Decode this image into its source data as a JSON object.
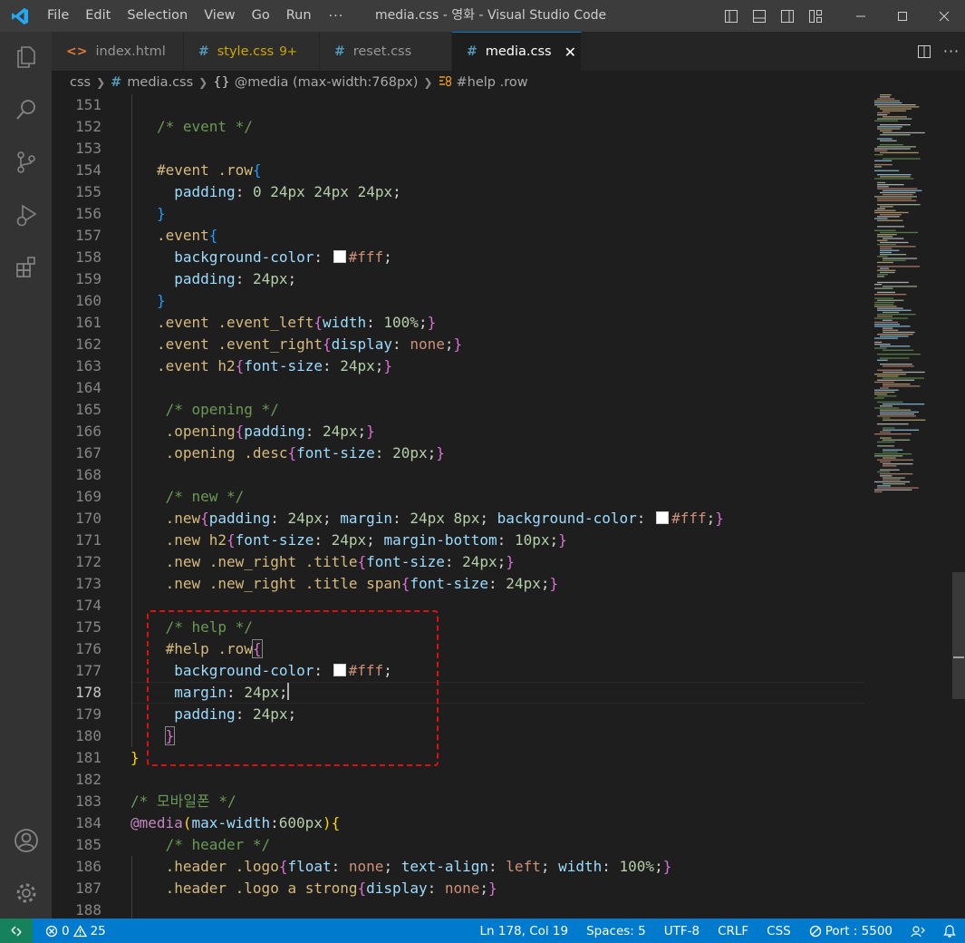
{
  "window": {
    "title": "media.css - 영화 - Visual Studio Code",
    "menu": [
      "File",
      "Edit",
      "Selection",
      "View",
      "Go",
      "Run"
    ],
    "menu_more": "···"
  },
  "tabs": [
    {
      "label": "index.html",
      "icon": "html-icon",
      "active": false
    },
    {
      "label": "style.css",
      "icon": "css-icon",
      "active": false,
      "count": "9+"
    },
    {
      "label": "reset.css",
      "icon": "css-icon",
      "active": false
    },
    {
      "label": "media.css",
      "icon": "css-icon",
      "active": true,
      "close": "✕"
    }
  ],
  "breadcrumb": {
    "folder": "css",
    "file": "media.css",
    "media": "@media (max-width:768px)",
    "rule": "#help .row"
  },
  "editor": {
    "current_line": 178,
    "lines": [
      {
        "n": "151"
      },
      {
        "n": "152",
        "text": "/* event */"
      },
      {
        "n": "153"
      },
      {
        "n": "154",
        "text": "#event .row{"
      },
      {
        "n": "155",
        "text": "padding: 0 24px 24px 24px;"
      },
      {
        "n": "156",
        "text": "}"
      },
      {
        "n": "157",
        "text": ".event{"
      },
      {
        "n": "158",
        "text": "background-color: #fff;"
      },
      {
        "n": "159",
        "text": "padding: 24px;"
      },
      {
        "n": "160",
        "text": "}"
      },
      {
        "n": "161",
        "text": ".event .event_left{width: 100%;}"
      },
      {
        "n": "162",
        "text": ".event .event_right{display: none;}"
      },
      {
        "n": "163",
        "text": ".event h2{font-size: 24px;}"
      },
      {
        "n": "164"
      },
      {
        "n": "165",
        "text": "/* opening */"
      },
      {
        "n": "166",
        "text": ".opening{padding: 24px;}"
      },
      {
        "n": "167",
        "text": ".opening .desc{font-size: 20px;}"
      },
      {
        "n": "168"
      },
      {
        "n": "169",
        "text": "/* new */"
      },
      {
        "n": "170",
        "text": ".new{padding: 24px; margin: 24px 8px; background-color: #fff;}"
      },
      {
        "n": "171",
        "text": ".new h2{font-size: 24px; margin-bottom: 10px;}"
      },
      {
        "n": "172",
        "text": ".new .new_right .title{font-size: 24px;}"
      },
      {
        "n": "173",
        "text": ".new .new_right .title span{font-size: 24px;}"
      },
      {
        "n": "174"
      },
      {
        "n": "175",
        "text": "/* help */"
      },
      {
        "n": "176",
        "text": "#help .row{"
      },
      {
        "n": "177",
        "text": "background-color: #fff;"
      },
      {
        "n": "178",
        "text": "margin: 24px;"
      },
      {
        "n": "179",
        "text": "padding: 24px;"
      },
      {
        "n": "180",
        "text": "}"
      },
      {
        "n": "181",
        "text": "}"
      },
      {
        "n": "182"
      },
      {
        "n": "183",
        "text": "/* 모바일폰 */"
      },
      {
        "n": "184",
        "text": "@media(max-width:600px){"
      },
      {
        "n": "185",
        "text": "/* header */"
      },
      {
        "n": "186",
        "text": ".header .logo{float: none; text-align: left; width: 100%;}"
      },
      {
        "n": "187",
        "text": ".header .logo a strong{display: none;}"
      },
      {
        "n": "188"
      }
    ]
  },
  "status": {
    "errors": "0",
    "warnings": "25",
    "position": "Ln 178, Col 19",
    "spaces": "Spaces: 5",
    "encoding": "UTF-8",
    "eol": "CRLF",
    "language": "CSS",
    "port": "Port : 5500"
  },
  "colors": {
    "accent": "#007acc",
    "highlight_box": "#e01010"
  }
}
